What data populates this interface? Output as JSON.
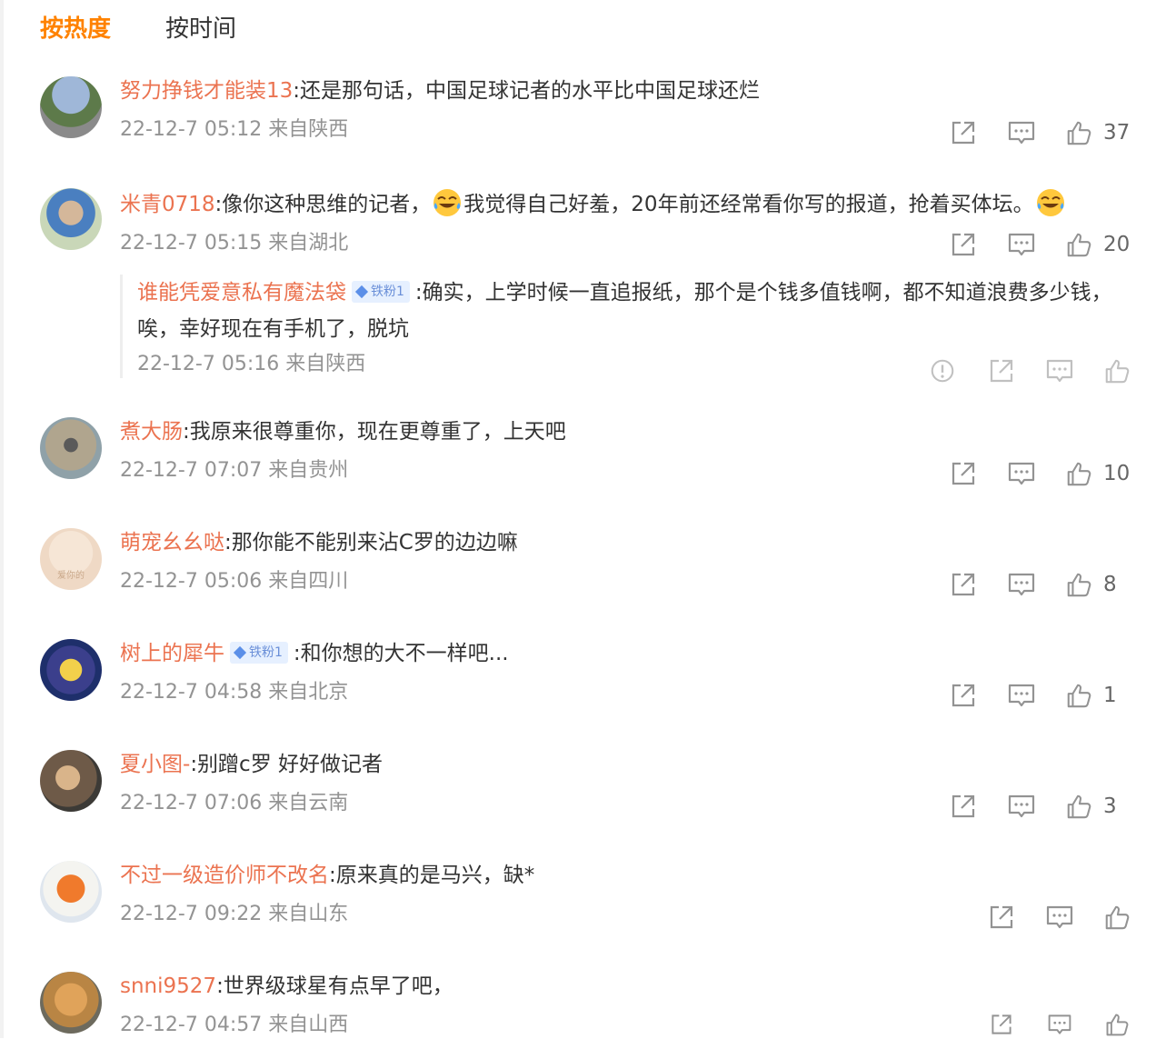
{
  "tabs": [
    {
      "label": "按热度"
    },
    {
      "label": "按时间"
    }
  ],
  "colors": {
    "accent": "#ff8200",
    "username": "#eb7350",
    "meta": "#939393"
  },
  "comments": [
    {
      "user": "努力挣钱才能装13",
      "text": ":还是那句话，中国足球记者的水平比中国足球还烂",
      "meta": "22-12-7 05:12 来自陕西",
      "likes": "37"
    },
    {
      "user": "米青0718",
      "text1": ":像你这种思维的记者，",
      "text2": "我觉得自己好羞，20年前还经常看你写的报道，抢着买体坛。",
      "meta": "22-12-7 05:15 来自湖北",
      "likes": "20",
      "emoji": "laugh-cry-emoji"
    },
    {
      "user": "煮大肠",
      "text": ":我原来很尊重你，现在更尊重了，上天吧",
      "meta": "22-12-7 07:07 来自贵州",
      "likes": "10"
    },
    {
      "user": "萌宠幺幺哒",
      "text": ":那你能不能别来沾C罗的边边嘛",
      "meta": "22-12-7 05:06 来自四川",
      "likes": "8",
      "avatar_text": "爱你的"
    },
    {
      "user": "树上的犀牛",
      "badge": "铁粉1",
      "text": ":和你想的大不一样吧...",
      "meta": "22-12-7 04:58 来自北京",
      "likes": "1"
    },
    {
      "user": "夏小图-",
      "text": ":别蹭c罗 好好做记者",
      "meta": "22-12-7 07:06 来自云南",
      "likes": "3"
    },
    {
      "user": "不过一级造价师不改名",
      "text": ":原来真的是马兴，缺*",
      "meta": "22-12-7 09:22 来自山东",
      "likes": ""
    },
    {
      "user": "snni9527",
      "text": ":世界级球星有点早了吧，",
      "meta": "22-12-7 04:57 来自山西",
      "likes": ""
    }
  ],
  "reply": {
    "user": "谁能凭爱意私有魔法袋",
    "badge": "铁粉1",
    "text": ":确实，上学时候一直追报纸，那个是个钱多值钱啊，都不知道浪费多少钱，唉，幸好现在有手机了，脱坑",
    "meta": "22-12-7 05:16 来自陕西"
  }
}
